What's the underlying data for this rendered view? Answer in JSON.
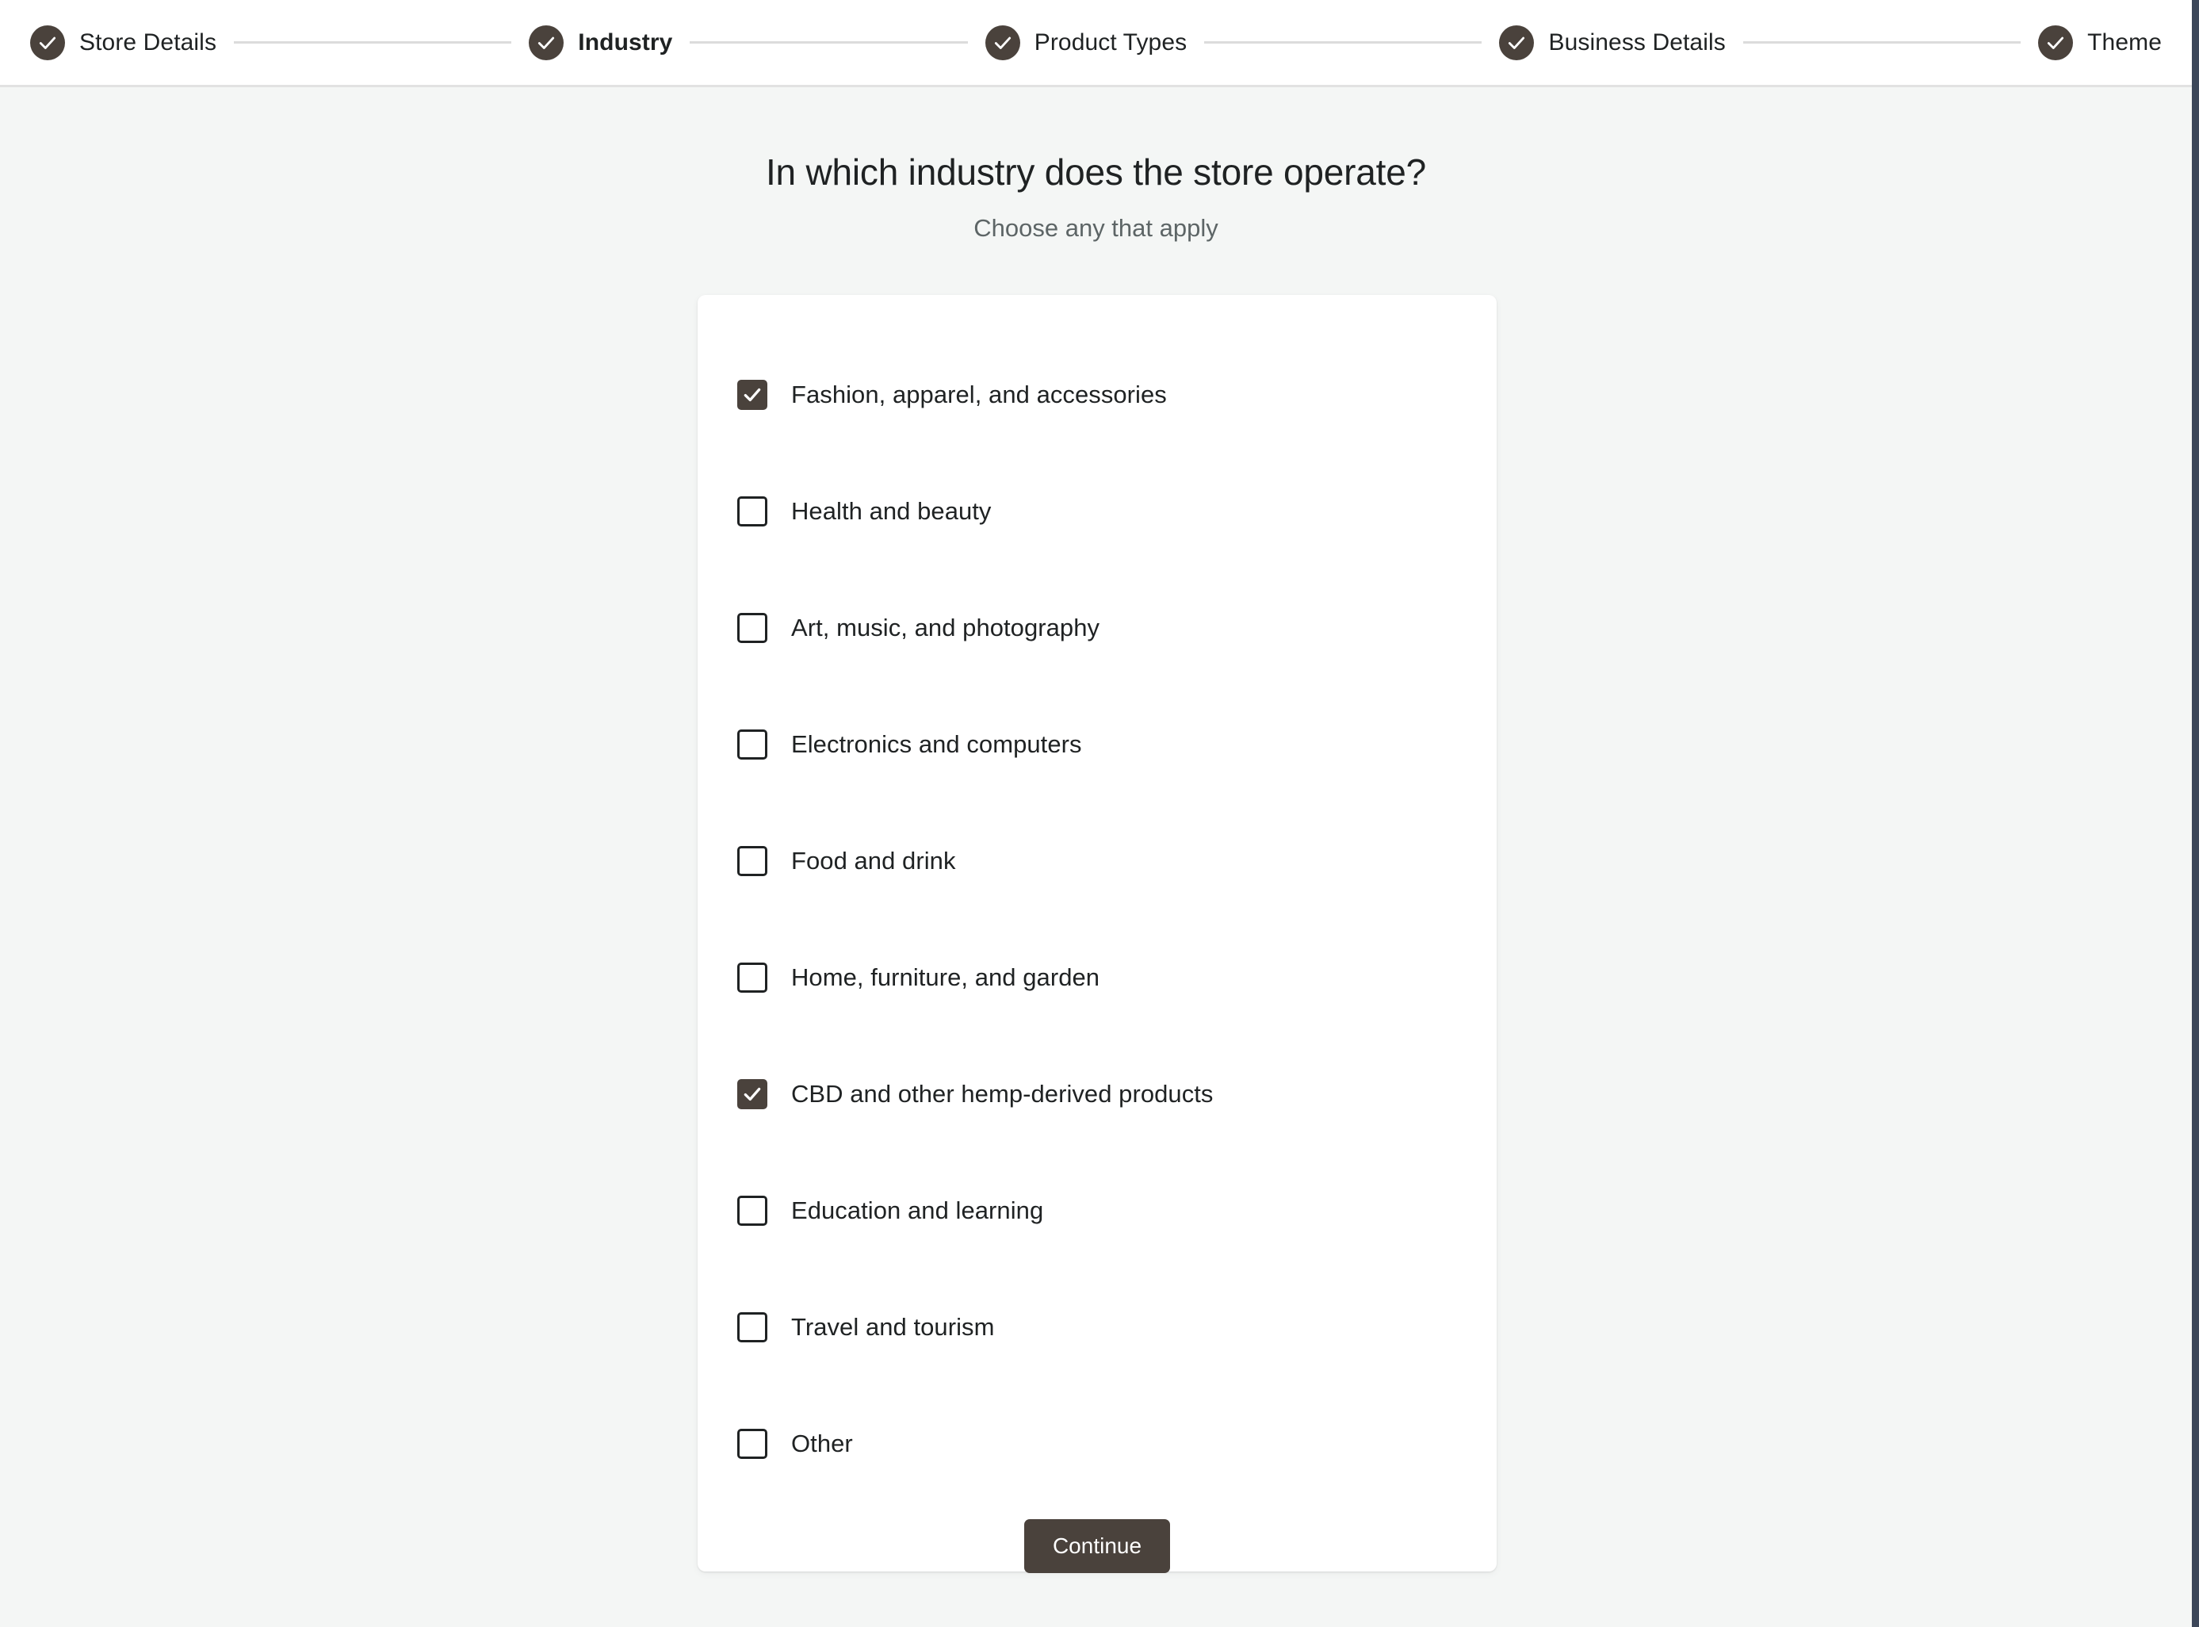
{
  "stepper": {
    "steps": [
      {
        "label": "Store Details",
        "completed": true,
        "current": false,
        "icon": "check-circle-icon"
      },
      {
        "label": "Industry",
        "completed": true,
        "current": true,
        "icon": "check-circle-icon"
      },
      {
        "label": "Product Types",
        "completed": true,
        "current": false,
        "icon": "check-circle-icon"
      },
      {
        "label": "Business Details",
        "completed": true,
        "current": false,
        "icon": "check-circle-icon"
      },
      {
        "label": "Theme",
        "completed": true,
        "current": false,
        "icon": "check-circle-icon"
      }
    ]
  },
  "main": {
    "title": "In which industry does the store operate?",
    "subtitle": "Choose any that apply"
  },
  "options": [
    {
      "label": "Fashion, apparel, and accessories",
      "checked": true
    },
    {
      "label": "Health and beauty",
      "checked": false
    },
    {
      "label": "Art, music, and photography",
      "checked": false
    },
    {
      "label": "Electronics and computers",
      "checked": false
    },
    {
      "label": "Food and drink",
      "checked": false
    },
    {
      "label": "Home, furniture, and garden",
      "checked": false
    },
    {
      "label": "CBD and other hemp-derived products",
      "checked": true
    },
    {
      "label": "Education and learning",
      "checked": false
    },
    {
      "label": "Travel and tourism",
      "checked": false
    },
    {
      "label": "Other",
      "checked": false
    }
  ],
  "actions": {
    "continue_label": "Continue"
  },
  "colors": {
    "accent": "#4a423c",
    "page_background": "#f4f6f5",
    "card_background": "#ffffff",
    "text_primary": "#1f2223",
    "text_secondary": "#5d6566",
    "divider": "#dcdcdc"
  }
}
